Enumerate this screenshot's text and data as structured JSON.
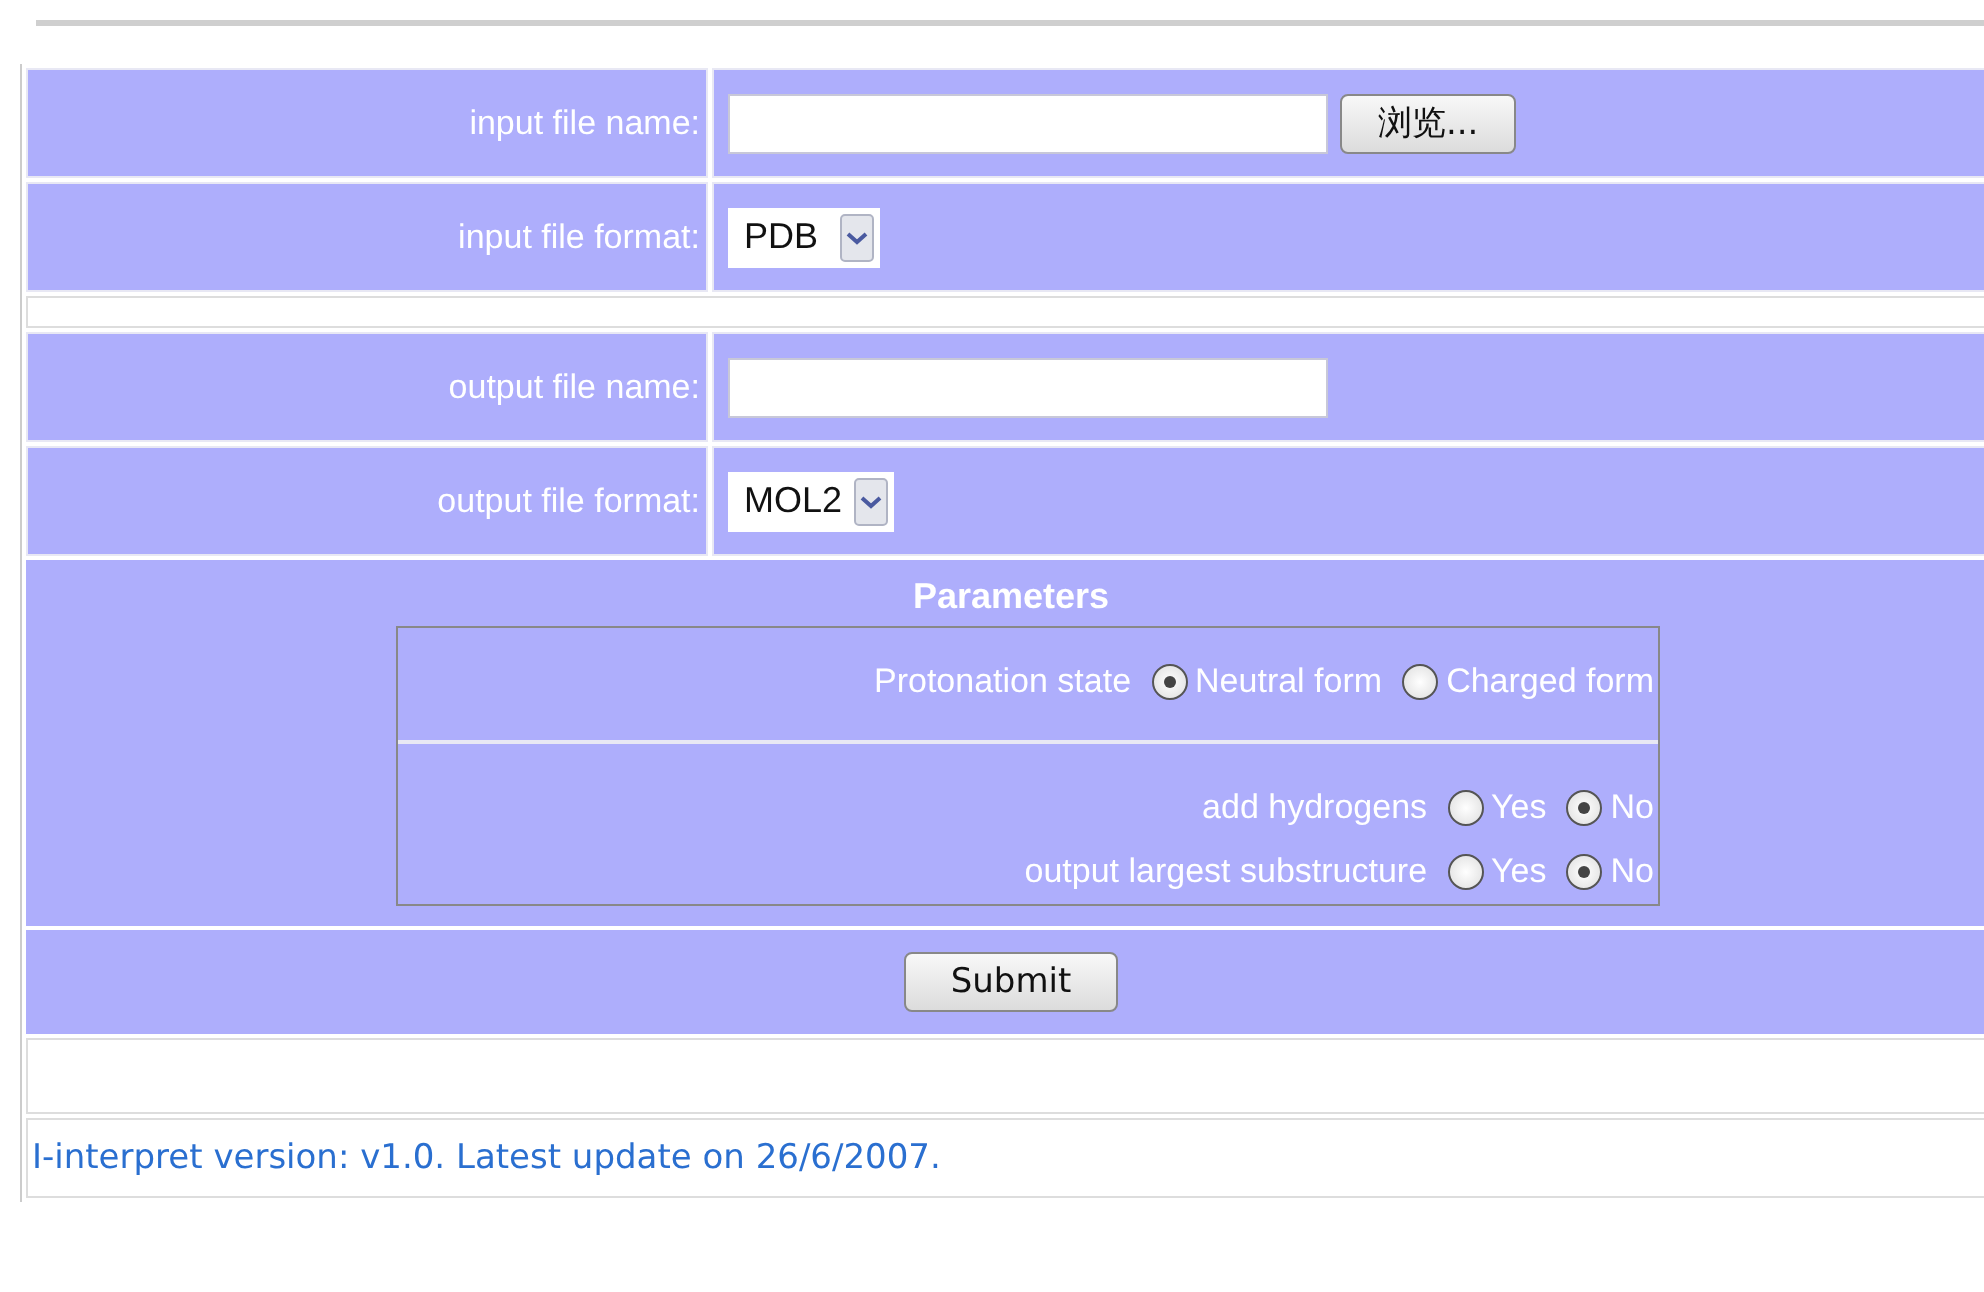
{
  "form": {
    "rows": [
      {
        "kind": "file",
        "label": "input file name:",
        "button": "浏览..."
      },
      {
        "kind": "select",
        "label": "input file format:",
        "value": "PDB"
      },
      {
        "kind": "spacer"
      },
      {
        "kind": "text",
        "label": "output file name:"
      },
      {
        "kind": "select",
        "label": "output file format:",
        "value": "MOL2"
      }
    ],
    "parameters": {
      "title": "Parameters",
      "groups": [
        {
          "label": "Protonation state",
          "options": [
            {
              "label": "Neutral form",
              "selected": true
            },
            {
              "label": "Charged form",
              "selected": false
            }
          ]
        },
        {
          "label": "add hydrogens",
          "options": [
            {
              "label": "Yes",
              "selected": false
            },
            {
              "label": "No",
              "selected": true
            }
          ]
        },
        {
          "label": "output largest substructure",
          "options": [
            {
              "label": "Yes",
              "selected": false
            },
            {
              "label": "No",
              "selected": true
            }
          ]
        }
      ]
    },
    "submit": "Submit"
  },
  "footer": "I-interpret version: v1.0.   Latest update on 26/6/2007."
}
